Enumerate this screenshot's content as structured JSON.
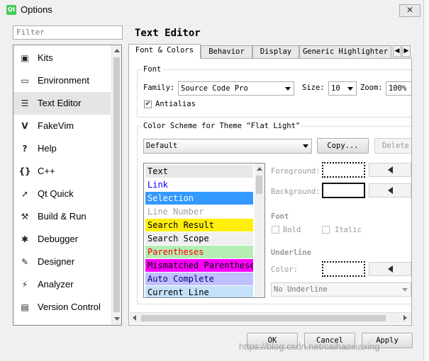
{
  "window": {
    "title": "Options",
    "logo_text": "Qt",
    "close_glyph": "✕"
  },
  "sidebar": {
    "filter_placeholder": "Filter",
    "items": [
      {
        "label": "Kits",
        "icon": "kits-icon",
        "glyph": "▣"
      },
      {
        "label": "Environment",
        "icon": "monitor-icon",
        "glyph": "▭"
      },
      {
        "label": "Text Editor",
        "icon": "text-editor-icon",
        "glyph": "☰"
      },
      {
        "label": "FakeVim",
        "icon": "fakevim-icon",
        "glyph": "V"
      },
      {
        "label": "Help",
        "icon": "help-icon",
        "glyph": "?"
      },
      {
        "label": "C++",
        "icon": "cpp-braces-icon",
        "glyph": "{}"
      },
      {
        "label": "Qt Quick",
        "icon": "qt-quick-icon",
        "glyph": "➚"
      },
      {
        "label": "Build & Run",
        "icon": "hammer-icon",
        "glyph": "⚒"
      },
      {
        "label": "Debugger",
        "icon": "bug-icon",
        "glyph": "✱"
      },
      {
        "label": "Designer",
        "icon": "pen-icon",
        "glyph": "✎"
      },
      {
        "label": "Analyzer",
        "icon": "analyzer-icon",
        "glyph": "⚡"
      },
      {
        "label": "Version Control",
        "icon": "version-control-icon",
        "glyph": "▤"
      }
    ]
  },
  "page": {
    "title": "Text Editor",
    "tabs": [
      "Font & Colors",
      "Behavior",
      "Display",
      "Generic Highlighter"
    ]
  },
  "font_group": {
    "title": "Font",
    "family_label": "Family:",
    "family_value": "Source Code Pro",
    "size_label": "Size:",
    "size_value": "10",
    "zoom_label": "Zoom:",
    "zoom_value": "100%",
    "antialias_label": "Antialias",
    "antialias_checked": true
  },
  "color_scheme": {
    "title": "Color Scheme for Theme \"Flat Light\"",
    "scheme_value": "Default",
    "copy_label": "Copy...",
    "delete_label": "Delete",
    "items": [
      {
        "label": "Text",
        "fg": "#000000",
        "bg": "#e8e8e8"
      },
      {
        "label": "Link",
        "fg": "#0000ff",
        "bg": "#ffffff"
      },
      {
        "label": "Selection",
        "fg": "#ffffff",
        "bg": "#3399ff"
      },
      {
        "label": "Line Number",
        "fg": "#9f9f9f",
        "bg": "#ffffff"
      },
      {
        "label": "Search Result",
        "fg": "#000000",
        "bg": "#ffef0b"
      },
      {
        "label": "Search Scope",
        "fg": "#000000",
        "bg": "#efefef"
      },
      {
        "label": "Parentheses",
        "fg": "#ff0000",
        "bg": "#b4eeb4"
      },
      {
        "label": "Mismatched Parentheses",
        "fg": "#000000",
        "bg": "#ff00ff"
      },
      {
        "label": "Auto Complete",
        "fg": "#000080",
        "bg": "#c0c0ff"
      },
      {
        "label": "Current Line",
        "fg": "#000000",
        "bg": "#c4e1f9"
      }
    ],
    "foreground_label": "Foreground:",
    "background_label": "Background:",
    "font_label": "Font",
    "bold_label": "Bold",
    "italic_label": "Italic",
    "underline_label": "Underline",
    "color_label": "Color:",
    "underline_style": "No Underline"
  },
  "buttons": {
    "ok": "OK",
    "cancel": "Cancel",
    "apply": "Apply"
  },
  "watermark": "https://blog.csdn.net/caihaoxiaxing"
}
